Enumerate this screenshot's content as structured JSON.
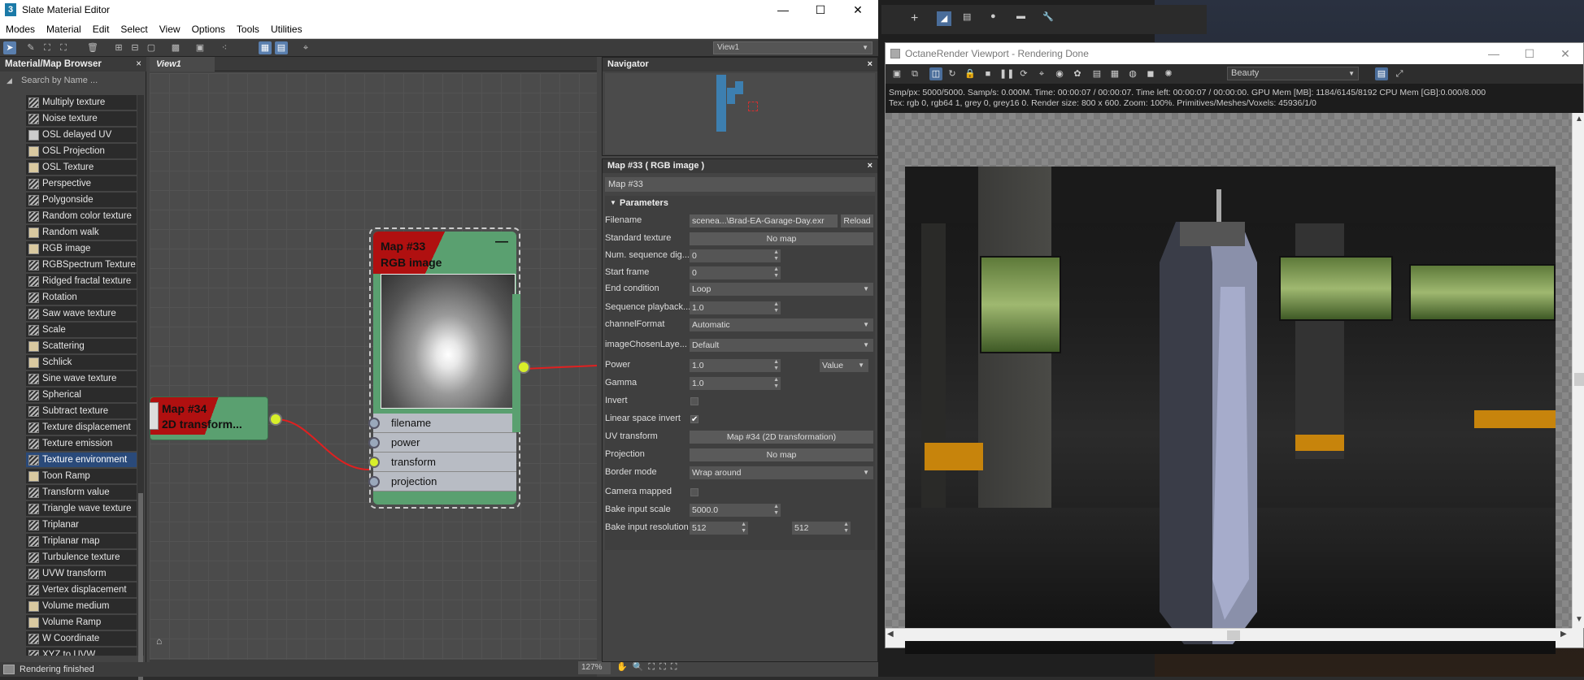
{
  "slate": {
    "window_title": "Slate Material Editor",
    "app_icon": "3",
    "menu": [
      "Modes",
      "Material",
      "Edit",
      "Select",
      "View",
      "Options",
      "Tools",
      "Utilities"
    ],
    "view_selector": "View1",
    "browser": {
      "title": "Material/Map Browser",
      "close": "×",
      "search_placeholder": "Search by Name ...",
      "items": [
        {
          "label": "Multiply texture",
          "icon": "hatch"
        },
        {
          "label": "Noise texture",
          "icon": "hatch"
        },
        {
          "label": "OSL delayed UV",
          "icon": "box"
        },
        {
          "label": "OSL Projection",
          "icon": "dot"
        },
        {
          "label": "OSL Texture",
          "icon": "dot"
        },
        {
          "label": "Perspective",
          "icon": "hatch"
        },
        {
          "label": "Polygonside",
          "icon": "hatch"
        },
        {
          "label": "Random color texture",
          "icon": "hatch"
        },
        {
          "label": "Random walk",
          "icon": "dot"
        },
        {
          "label": "RGB image",
          "icon": "dot"
        },
        {
          "label": "RGBSpectrum Texture",
          "icon": "hatch"
        },
        {
          "label": "Ridged fractal texture",
          "icon": "hatch"
        },
        {
          "label": "Rotation",
          "icon": "hatch"
        },
        {
          "label": "Saw wave texture",
          "icon": "hatch"
        },
        {
          "label": "Scale",
          "icon": "hatch"
        },
        {
          "label": "Scattering",
          "icon": "dot"
        },
        {
          "label": "Schlick",
          "icon": "dot"
        },
        {
          "label": "Sine wave texture",
          "icon": "hatch"
        },
        {
          "label": "Spherical",
          "icon": "hatch"
        },
        {
          "label": "Subtract texture",
          "icon": "hatch"
        },
        {
          "label": "Texture displacement",
          "icon": "hatch"
        },
        {
          "label": "Texture emission",
          "icon": "hatch"
        },
        {
          "label": "Texture environment",
          "icon": "hatch",
          "selected": true
        },
        {
          "label": "Toon Ramp",
          "icon": "dot"
        },
        {
          "label": "Transform value",
          "icon": "hatch"
        },
        {
          "label": "Triangle wave texture",
          "icon": "hatch"
        },
        {
          "label": "Triplanar",
          "icon": "hatch"
        },
        {
          "label": "Triplanar map",
          "icon": "hatch"
        },
        {
          "label": "Turbulence texture",
          "icon": "hatch"
        },
        {
          "label": "UVW transform",
          "icon": "hatch"
        },
        {
          "label": "Vertex displacement",
          "icon": "hatch"
        },
        {
          "label": "Volume medium",
          "icon": "dot"
        },
        {
          "label": "Volume Ramp",
          "icon": "dot"
        },
        {
          "label": "W Coordinate",
          "icon": "hatch"
        },
        {
          "label": "XYZ to UVW",
          "icon": "hatch"
        }
      ]
    },
    "view_tab": "View1",
    "node_34": {
      "line1": "Map #34",
      "line2": "2D transform..."
    },
    "node_33": {
      "line1": "Map #33",
      "line2": "RGB image",
      "slots": [
        "filename",
        "power",
        "transform",
        "projection"
      ]
    },
    "navigator_title": "Navigator",
    "zoom": "127%",
    "status": "Rendering finished",
    "params": {
      "panel_title": "Map #33  ( RGB image )",
      "map_name": "Map #33",
      "section": "Parameters",
      "filename_label": "Filename",
      "filename_value": "scenea...\\Brad-EA-Garage-Day.exr",
      "reload": "Reload",
      "standard_texture_label": "Standard texture",
      "standard_texture_value": "No map",
      "num_seq_label": "Num. sequence dig...",
      "num_seq_value": "0",
      "start_frame_label": "Start frame",
      "start_frame_value": "0",
      "end_condition_label": "End condition",
      "end_condition_value": "Loop",
      "seq_playback_label": "Sequence playback...",
      "seq_playback_value": "1.0",
      "channel_format_label": "channelFormat",
      "channel_format_value": "Automatic",
      "image_layer_label": "imageChosenLaye...",
      "image_layer_value": "Default",
      "power_label": "Power",
      "power_value": "1.0",
      "power_mode": "Value",
      "gamma_label": "Gamma",
      "gamma_value": "1.0",
      "invert_label": "Invert",
      "invert_checked": false,
      "linear_label": "Linear space invert",
      "linear_checked": true,
      "uv_label": "UV transform",
      "uv_value": "Map #34 (2D transformation)",
      "projection_label": "Projection",
      "projection_value": "No map",
      "border_label": "Border mode",
      "border_value": "Wrap around",
      "camera_label": "Camera mapped",
      "camera_checked": false,
      "bake_scale_label": "Bake input scale",
      "bake_scale_value": "5000.0",
      "bake_res_label": "Bake input resolution",
      "bake_res_x": "512",
      "bake_res_y": "512"
    }
  },
  "octane": {
    "window_title": "OctaneRender Viewport - Rendering Done",
    "render_pass": "Beauty",
    "info_line1": "Smp/px: 5000/5000.   Samp/s: 0.000M.   Time: 00:00:07 / 00:00:07.   Time left: 00:00:07 / 00:00:00.   GPU Mem [MB]: 1184/6145/8192   CPU Mem [GB]:0.000/8.000",
    "info_line2": "Tex: rgb 0, rgb64 1, grey 0, grey16 0.   Render size: 800 x 600.   Zoom: 100%.   Primitives/Meshes/Voxels: 45936/1/0"
  },
  "colors": {
    "node_green": "#5aa070",
    "node_red": "#b01010",
    "port_yellow": "#d8ef2a",
    "selection_blue": "#2a4a7a",
    "wire": "#e02020"
  }
}
